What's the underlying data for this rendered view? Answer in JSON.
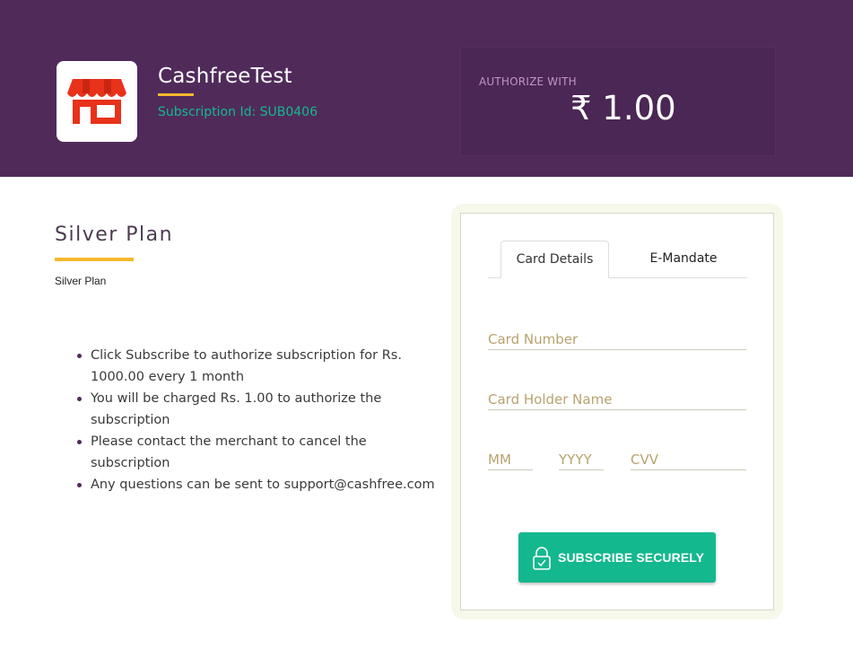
{
  "header": {
    "merchant_name": "CashfreeTest",
    "subscription_id": "Subscription Id: SUB0406",
    "logo_icon": "store-icon",
    "authorize_label": "AUTHORIZE WITH",
    "amount": "₹ 1.00"
  },
  "plan": {
    "title": "Silver Plan",
    "description": "Silver Plan",
    "bullets": [
      "Click Subscribe to authorize subscription for Rs. 1000.00 every 1 month",
      "You will be charged Rs. 1.00 to authorize the subscription",
      "Please contact the merchant to cancel the subscription",
      "Any questions can be sent to support@cashfree.com"
    ]
  },
  "form": {
    "tabs": [
      {
        "label": "Card Details",
        "active": true
      },
      {
        "label": "E-Mandate",
        "active": false
      }
    ],
    "fields": {
      "card_number": {
        "placeholder": "Card Number",
        "value": ""
      },
      "card_holder": {
        "placeholder": "Card Holder Name",
        "value": ""
      },
      "month": {
        "placeholder": "MM",
        "value": ""
      },
      "year": {
        "placeholder": "YYYY",
        "value": ""
      },
      "cvv": {
        "placeholder": "CVV",
        "value": ""
      }
    },
    "submit_label": "SUBSCRIBE SECURELY",
    "submit_icon": "lock-icon"
  },
  "colors": {
    "header_bg": "#502b5a",
    "accent_green": "#14b88e",
    "accent_yellow": "#f5b82e"
  }
}
